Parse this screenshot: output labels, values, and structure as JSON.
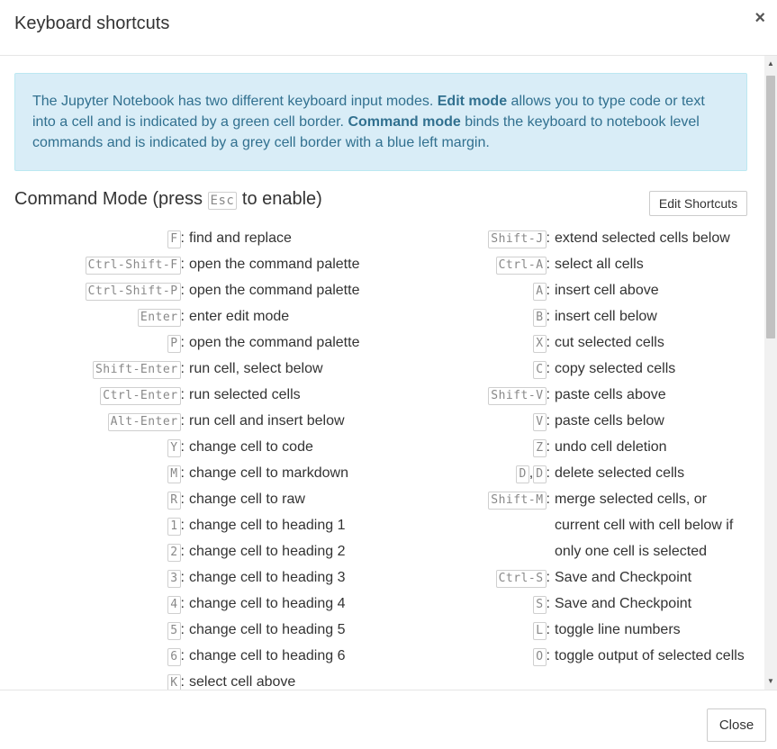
{
  "header": {
    "title": "Keyboard shortcuts",
    "close_glyph": "×"
  },
  "info": {
    "t1": "The Jupyter Notebook has two different keyboard input modes. ",
    "b1": "Edit mode",
    "t2": " allows you to type code or text into a cell and is indicated by a green cell border. ",
    "b2": "Command mode",
    "t3": " binds the keyboard to notebook level commands and is indicated by a grey cell border with a blue left margin."
  },
  "command_mode": {
    "title_pre": "Command Mode (press ",
    "title_key": "Esc",
    "title_post": " to enable)",
    "edit_button": "Edit Shortcuts"
  },
  "left_shortcuts": [
    {
      "keys": [
        "F"
      ],
      "desc": "find and replace"
    },
    {
      "keys": [
        "Ctrl-Shift-F"
      ],
      "desc": "open the command palette"
    },
    {
      "keys": [
        "Ctrl-Shift-P"
      ],
      "desc": "open the command palette"
    },
    {
      "keys": [
        "Enter"
      ],
      "desc": "enter edit mode"
    },
    {
      "keys": [
        "P"
      ],
      "desc": "open the command palette"
    },
    {
      "keys": [
        "Shift-Enter"
      ],
      "desc": "run cell, select below"
    },
    {
      "keys": [
        "Ctrl-Enter"
      ],
      "desc": "run selected cells"
    },
    {
      "keys": [
        "Alt-Enter"
      ],
      "desc": "run cell and insert below"
    },
    {
      "keys": [
        "Y"
      ],
      "desc": "change cell to code"
    },
    {
      "keys": [
        "M"
      ],
      "desc": "change cell to markdown"
    },
    {
      "keys": [
        "R"
      ],
      "desc": "change cell to raw"
    },
    {
      "keys": [
        "1"
      ],
      "desc": "change cell to heading 1"
    },
    {
      "keys": [
        "2"
      ],
      "desc": "change cell to heading 2"
    },
    {
      "keys": [
        "3"
      ],
      "desc": "change cell to heading 3"
    },
    {
      "keys": [
        "4"
      ],
      "desc": "change cell to heading 4"
    },
    {
      "keys": [
        "5"
      ],
      "desc": "change cell to heading 5"
    },
    {
      "keys": [
        "6"
      ],
      "desc": "change cell to heading 6"
    },
    {
      "keys": [
        "K"
      ],
      "desc": "select cell above"
    }
  ],
  "right_shortcuts": [
    {
      "keys": [
        "Shift-J"
      ],
      "desc": "extend selected cells below"
    },
    {
      "keys": [
        "Ctrl-A"
      ],
      "desc": "select all cells"
    },
    {
      "keys": [
        "A"
      ],
      "desc": "insert cell above"
    },
    {
      "keys": [
        "B"
      ],
      "desc": "insert cell below"
    },
    {
      "keys": [
        "X"
      ],
      "desc": "cut selected cells"
    },
    {
      "keys": [
        "C"
      ],
      "desc": "copy selected cells"
    },
    {
      "keys": [
        "Shift-V"
      ],
      "desc": "paste cells above"
    },
    {
      "keys": [
        "V"
      ],
      "desc": "paste cells below"
    },
    {
      "keys": [
        "Z"
      ],
      "desc": "undo cell deletion"
    },
    {
      "keys": [
        "D",
        "D"
      ],
      "desc": "delete selected cells"
    },
    {
      "keys": [
        "Shift-M"
      ],
      "desc": "merge selected cells, or current cell with cell below if only one cell is selected"
    },
    {
      "keys": [
        "Ctrl-S"
      ],
      "desc": "Save and Checkpoint"
    },
    {
      "keys": [
        "S"
      ],
      "desc": "Save and Checkpoint"
    },
    {
      "keys": [
        "L"
      ],
      "desc": "toggle line numbers"
    },
    {
      "keys": [
        "O"
      ],
      "desc": "toggle output of selected cells"
    }
  ],
  "footer": {
    "close_label": "Close"
  }
}
